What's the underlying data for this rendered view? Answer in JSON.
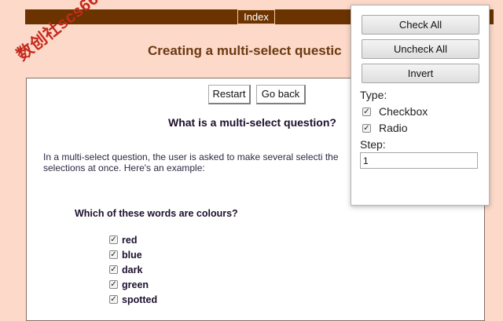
{
  "header": {
    "index_label": "Index"
  },
  "page": {
    "title": "Creating a multi-select questic"
  },
  "watermark": {
    "text": "数创社scs66"
  },
  "nav": {
    "restart_label": "Restart",
    "goback_label": "Go back"
  },
  "content": {
    "heading": "What is a multi-select question?",
    "intro": "In a multi-select question, the user is asked to make several selecti the selections at once. Here's an example:",
    "question": "Which of these words are colours?",
    "options": [
      {
        "label": "red",
        "checked": true
      },
      {
        "label": "blue",
        "checked": true
      },
      {
        "label": "dark",
        "checked": true
      },
      {
        "label": "green",
        "checked": true
      },
      {
        "label": "spotted",
        "checked": true
      }
    ]
  },
  "popup": {
    "check_all_label": "Check All",
    "uncheck_all_label": "Uncheck All",
    "invert_label": "Invert",
    "type_label": "Type:",
    "checkbox_label": "Checkbox",
    "radio_label": "Radio",
    "step_label": "Step:",
    "step_value": "1"
  }
}
